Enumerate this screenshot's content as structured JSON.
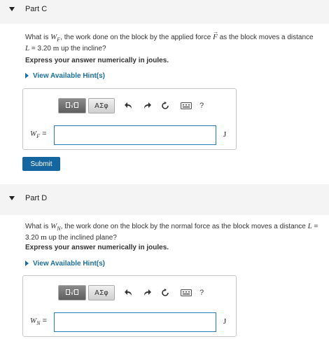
{
  "partC": {
    "title": "Part C",
    "question": {
      "pre": "What is ",
      "sym": "W",
      "sub": "F",
      "mid": ", the work done on the block by the applied force ",
      "vec": "F",
      "post": " as the block moves a distance",
      "line2_sym": "L",
      "line2_eq": " = 3.20 ",
      "line2_unit": "m",
      "line2_post": " up the incline?"
    },
    "express": "Express your answer numerically in joules.",
    "hint": "View Available Hint(s)",
    "answer_label_sym": "W",
    "answer_label_sub": "F",
    "answer_label_eq": " =",
    "answer_value": "",
    "unit": "J",
    "submit": "Submit"
  },
  "partD": {
    "title": "Part D",
    "question": {
      "pre": "What is ",
      "sym": "W",
      "sub": "N",
      "mid": ", the work done on the block by the normal force as the block moves a distance ",
      "sym2": "L",
      "eq": " =",
      "line2_val": "3.20 ",
      "line2_unit": "m",
      "line2_post": " up the inclined plane?"
    },
    "express": "Express your answer numerically in joules.",
    "hint": "View Available Hint(s)",
    "answer_label_sym": "W",
    "answer_label_sub": "N",
    "answer_label_eq": " =",
    "answer_value": "",
    "unit": "J"
  },
  "toolbar": {
    "template_icon": "templates-icon",
    "greek_label": "ΑΣφ",
    "undo_icon": "undo-icon",
    "redo_icon": "redo-icon",
    "reset_icon": "reset-icon",
    "keyboard_icon": "keyboard-icon",
    "help_label": "?"
  },
  "colors": {
    "link": "#1a6fa1",
    "submit_bg": "#1565a0",
    "input_border": "#2a7ab5",
    "header_bg": "#f4f4f4"
  }
}
